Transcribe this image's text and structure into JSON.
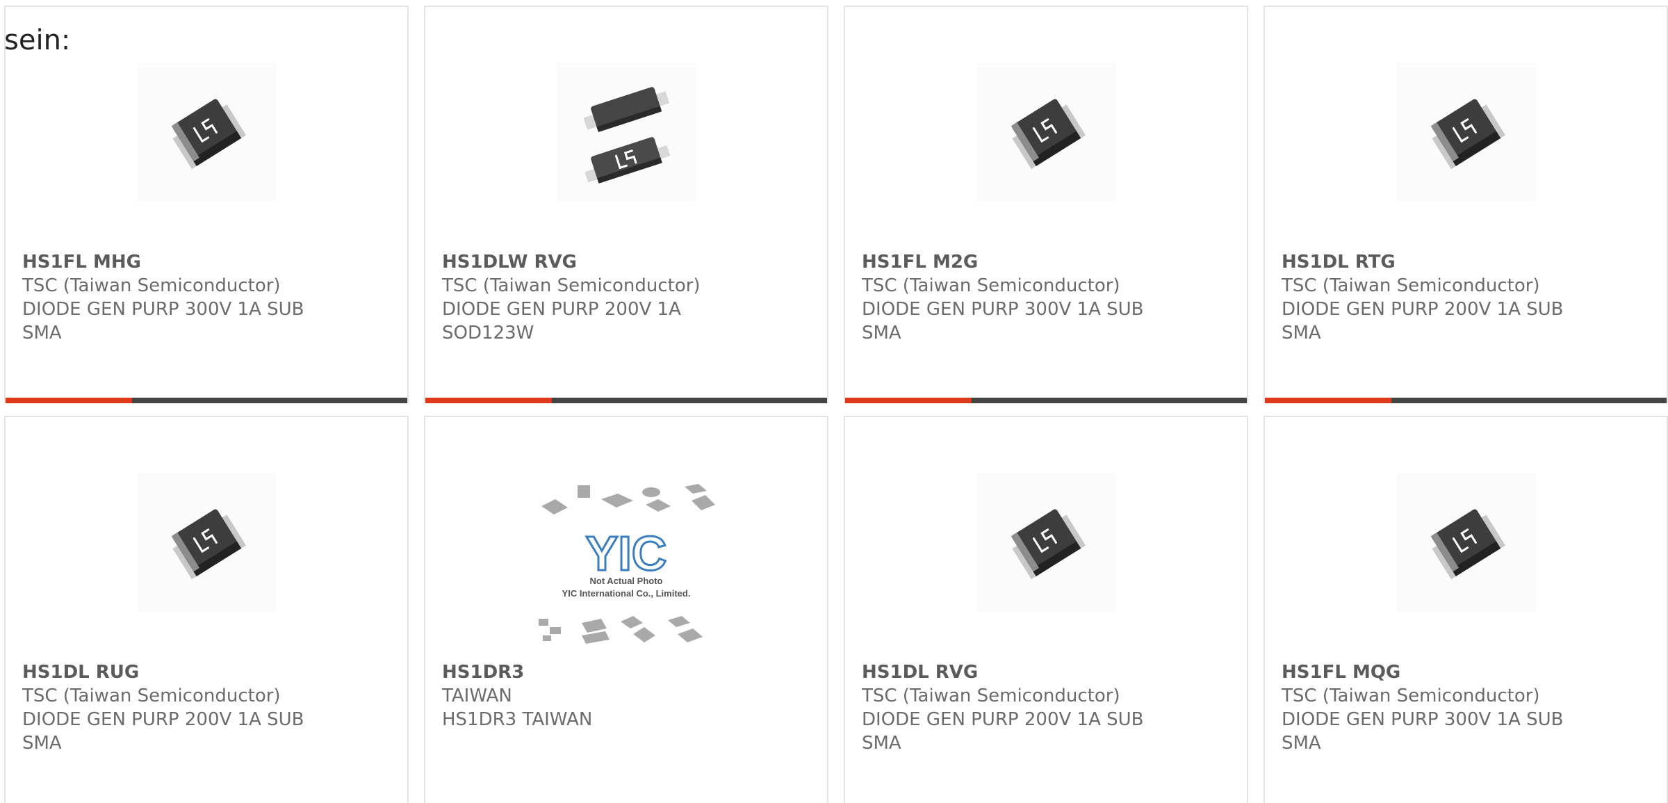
{
  "lead_text": "sein:",
  "colors": {
    "accent": "#e0381b",
    "bar": "#444444",
    "border": "#e4e4e4",
    "text": "#6b6b6b"
  },
  "products": [
    {
      "part": "HS1FL MHG",
      "manufacturer": "TSC (Taiwan Semiconductor)",
      "desc_line1": "DIODE GEN PURP 300V 1A SUB",
      "desc_line2": "SMA",
      "image": "sma-diode-icon"
    },
    {
      "part": "HS1DLW RVG",
      "manufacturer": "TSC (Taiwan Semiconductor)",
      "desc_line1": "DIODE GEN PURP 200V 1A",
      "desc_line2": "SOD123W",
      "image": "sod123w-diode-icon"
    },
    {
      "part": "HS1FL M2G",
      "manufacturer": "TSC (Taiwan Semiconductor)",
      "desc_line1": "DIODE GEN PURP 300V 1A SUB",
      "desc_line2": "SMA",
      "image": "sma-diode-icon"
    },
    {
      "part": "HS1DL RTG",
      "manufacturer": "TSC (Taiwan Semiconductor)",
      "desc_line1": "DIODE GEN PURP 200V 1A SUB",
      "desc_line2": "SMA",
      "image": "sma-diode-icon"
    },
    {
      "part": "HS1DL RUG",
      "manufacturer": "TSC (Taiwan Semiconductor)",
      "desc_line1": "DIODE GEN PURP 200V 1A SUB",
      "desc_line2": "SMA",
      "image": "sma-diode-icon"
    },
    {
      "part": "HS1DR3",
      "manufacturer": "TAIWAN",
      "desc_line1": "HS1DR3 TAIWAN",
      "desc_line2": "",
      "image": "placeholder-photo-icon",
      "placeholder_line1": "Not Actual Photo",
      "placeholder_line2": "YIC International Co., Limited.",
      "placeholder_logo": "YIC"
    },
    {
      "part": "HS1DL RVG",
      "manufacturer": "TSC (Taiwan Semiconductor)",
      "desc_line1": "DIODE GEN PURP 200V 1A SUB",
      "desc_line2": "SMA",
      "image": "sma-diode-icon"
    },
    {
      "part": "HS1FL MQG",
      "manufacturer": "TSC (Taiwan Semiconductor)",
      "desc_line1": "DIODE GEN PURP 300V 1A SUB",
      "desc_line2": "SMA",
      "image": "sma-diode-icon"
    }
  ]
}
